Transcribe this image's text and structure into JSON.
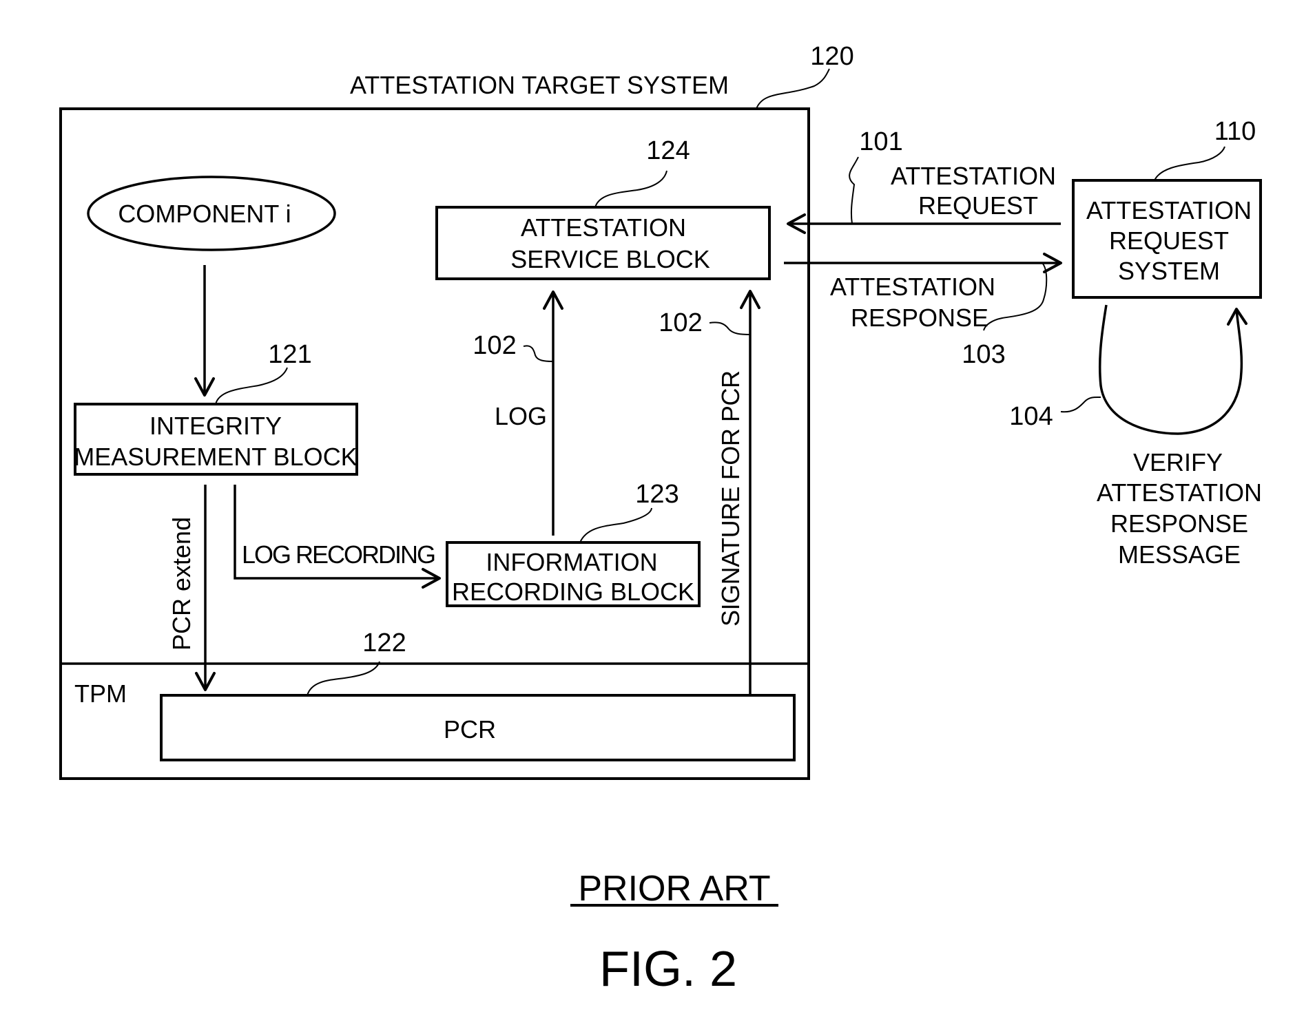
{
  "figure": {
    "caption_note": "PRIOR ART",
    "caption": "FIG. 2"
  },
  "target_system": {
    "title": "ATTESTATION TARGET SYSTEM",
    "ref": "120",
    "tpm_label": "TPM"
  },
  "nodes": {
    "component": {
      "label": "COMPONENT i"
    },
    "integrity_block": {
      "ref": "121",
      "lines": [
        "INTEGRITY",
        "MEASUREMENT BLOCK"
      ]
    },
    "pcr": {
      "ref": "122",
      "label": "PCR"
    },
    "info_block": {
      "ref": "123",
      "lines": [
        "INFORMATION",
        "RECORDING BLOCK"
      ]
    },
    "service_block": {
      "ref": "124",
      "lines": [
        "ATTESTATION",
        "SERVICE BLOCK"
      ]
    },
    "request_system": {
      "ref": "110",
      "lines": [
        "ATTESTATION",
        "REQUEST",
        "SYSTEM"
      ]
    }
  },
  "edges": {
    "pcr_extend": {
      "label": "PCR extend"
    },
    "log_recording": {
      "label": "LOG RECORDING"
    },
    "log": {
      "label": "LOG",
      "ref": "102"
    },
    "signature": {
      "label": "SIGNATURE FOR PCR",
      "ref": "102"
    },
    "request": {
      "ref": "101",
      "lines": [
        "ATTESTATION",
        "REQUEST"
      ]
    },
    "response": {
      "ref": "103",
      "lines": [
        "ATTESTATION",
        "RESPONSE"
      ]
    },
    "verify": {
      "ref": "104",
      "lines": [
        "VERIFY",
        "ATTESTATION",
        "RESPONSE",
        "MESSAGE"
      ]
    }
  }
}
